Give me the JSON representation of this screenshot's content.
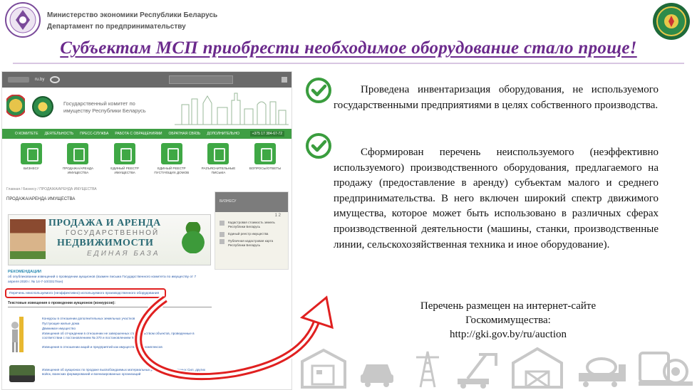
{
  "header": {
    "ministry_line1": "Министерство экономики Республики Беларусь",
    "ministry_line2": "Департамент по предпринимательству"
  },
  "title": "Субъектам МСП приобрести необходимое оборудование стало проще!",
  "screenshot": {
    "browser_lang": "ru.by",
    "site_name_line1": "Государственный комитет по",
    "site_name_line2": "имуществу Республики Беларусь",
    "menu": [
      "О КОМИТЕТЕ",
      "ДЕЯТЕЛЬНОСТЬ",
      "ПРЕСС-СЛУЖБА",
      "РАБОТА С ОБРАЩЕНИЯМИ",
      "ОБРАТНАЯ СВЯЗЬ",
      "ДОПОЛНИТЕЛЬНО"
    ],
    "phone": "+375 17 384-67-72",
    "tiles": [
      "БИЗНЕСУ",
      "ПРОДАЖА/АРЕНДА ИМУЩЕСТВА",
      "ЕДИНЫЙ РЕЕСТР ИМУЩЕСТВА",
      "ЕДИНЫЙ РЕЕСТР ПУСТУЮЩИХ ДОМОВ",
      "РАЗЪЯСНИТЕЛЬНЫЕ ПИСЬМА",
      "ВОПРОСЫ/ОТВЕТЫ"
    ],
    "breadcrumbs": "Главная / Бизнесу / ПРОДАЖА/АРЕНДА ИМУЩЕСТВА",
    "page_title": "ПРОДАЖА/АРЕНДА ИМУЩЕСТВА",
    "banner": {
      "line1": "ПРОДАЖА И АРЕНДА",
      "line2": "ГОСУДАРСТВЕННОЙ",
      "line3": "НЕДВИЖИМОСТИ",
      "line4": "ЕДИНАЯ БАЗА"
    },
    "reco_title": "РЕКОМЕНДАЦИИ",
    "reco_text": "об опубликовании извещений о проведении аукционов (взамен письма Государственного комитета по имуществу от 7 апреля 2020 г. № 14-7-10/3317/юн)",
    "highlight_link": "Перечень неиспользуемого (неэффективно) используемого производственного оборудования",
    "notices_heading": "Текстовые извещения о проведении аукционов (конкурсов):",
    "notices": [
      "Конкурсы в отношении дополнительных земельных участков",
      "Пустующие жилые дома",
      "Движимое имущество",
      "Извещения об отчуждении в отношении не завершенных строительством объектов, проведенные в соответствии с постановлением № 370 и постановлением № 220",
      "Извещения в отношении акций и предприятий как имущественных комплексов"
    ],
    "notice_last": "Извещения об аукционах по продаже высвобождаемых материальных ресурсов Вооруженных Сил, других войск, воинских формирований и военизированных организаций",
    "sidebar": {
      "heading": "БИЗНЕСУ",
      "pages": "1 2",
      "items": [
        "Кадастровая стоимость земель Республики Беларусь",
        "Единый реестр имущества",
        "Публичная кадастровая карта Республики Беларусь"
      ]
    }
  },
  "points": [
    "Проведена инвентаризация оборудования, не используемого государственными предприятиями в целях собственного производства.",
    "Сформирован перечень неиспользуемого (неэффективно используемого) производственного оборудования, предлагаемого на продажу (предоставление в аренду) субъектам малого и среднего предпринимательства. В него включен широкий спектр движимого имущества, которое может быть использовано в различных сферах производственной деятельности (машины, станки, производственные линии, сельскохозяйственная техника и иное оборудование)."
  ],
  "list_line1": "Перечень размещен на интернет-сайте",
  "list_line2": "Госкомимущества:",
  "list_url": "http://gki.gov.by/ru/auction",
  "colors": {
    "title": "#6b2a8c",
    "check": "#3a9d3e",
    "arrow": "#e02020",
    "site_green": "#3f9e44"
  },
  "icons": [
    "warehouse-icon",
    "car-icon",
    "power-tower-icon",
    "crane-truck-icon",
    "barn-icon",
    "concrete-mixer-icon",
    "industrial-machine-icon"
  ]
}
